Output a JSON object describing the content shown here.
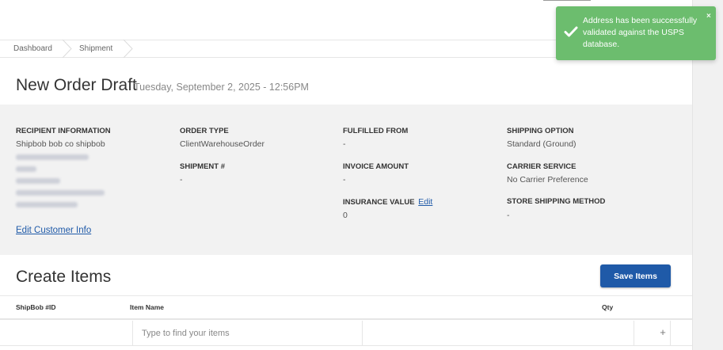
{
  "breadcrumb": {
    "items": [
      {
        "label": "Dashboard"
      },
      {
        "label": "Shipment"
      }
    ]
  },
  "header": {
    "title": "New Order Draft",
    "datetime": "Tuesday, September 2, 2025 - 12:56PM"
  },
  "recipient": {
    "label": "RECIPIENT INFORMATION",
    "name": "Shipbob bob co shipbob",
    "edit_link": "Edit Customer Info"
  },
  "order_type": {
    "label": "ORDER TYPE",
    "value": "ClientWarehouseOrder"
  },
  "shipment": {
    "label": "SHIPMENT #",
    "value": "-"
  },
  "fulfilled_from": {
    "label": "FULFILLED FROM",
    "value": "-"
  },
  "invoice_amount": {
    "label": "INVOICE AMOUNT",
    "value": "-"
  },
  "insurance_value": {
    "label": "INSURANCE VALUE",
    "edit_link": "Edit",
    "value": "0"
  },
  "shipping_option": {
    "label": "SHIPPING OPTION",
    "value": "Standard (Ground)"
  },
  "carrier_service": {
    "label": "CARRIER SERVICE",
    "value": "No Carrier Preference"
  },
  "store_shipping_method": {
    "label": "STORE SHIPPING METHOD",
    "value": "-"
  },
  "items_section": {
    "title": "Create Items",
    "save_label": "Save Items",
    "columns": [
      "ShipBob #ID",
      "Item Name",
      "Qty"
    ],
    "search_placeholder": "Type to find your items",
    "add_glyph": "+"
  },
  "toast": {
    "message": "Address has been successfully validated against the USPS database.",
    "close_glyph": "×",
    "icon": "checkmark-icon",
    "color": "#6cbd6e"
  },
  "colors": {
    "accent": "#1f5aa8",
    "panel": "#f2f2f2"
  }
}
